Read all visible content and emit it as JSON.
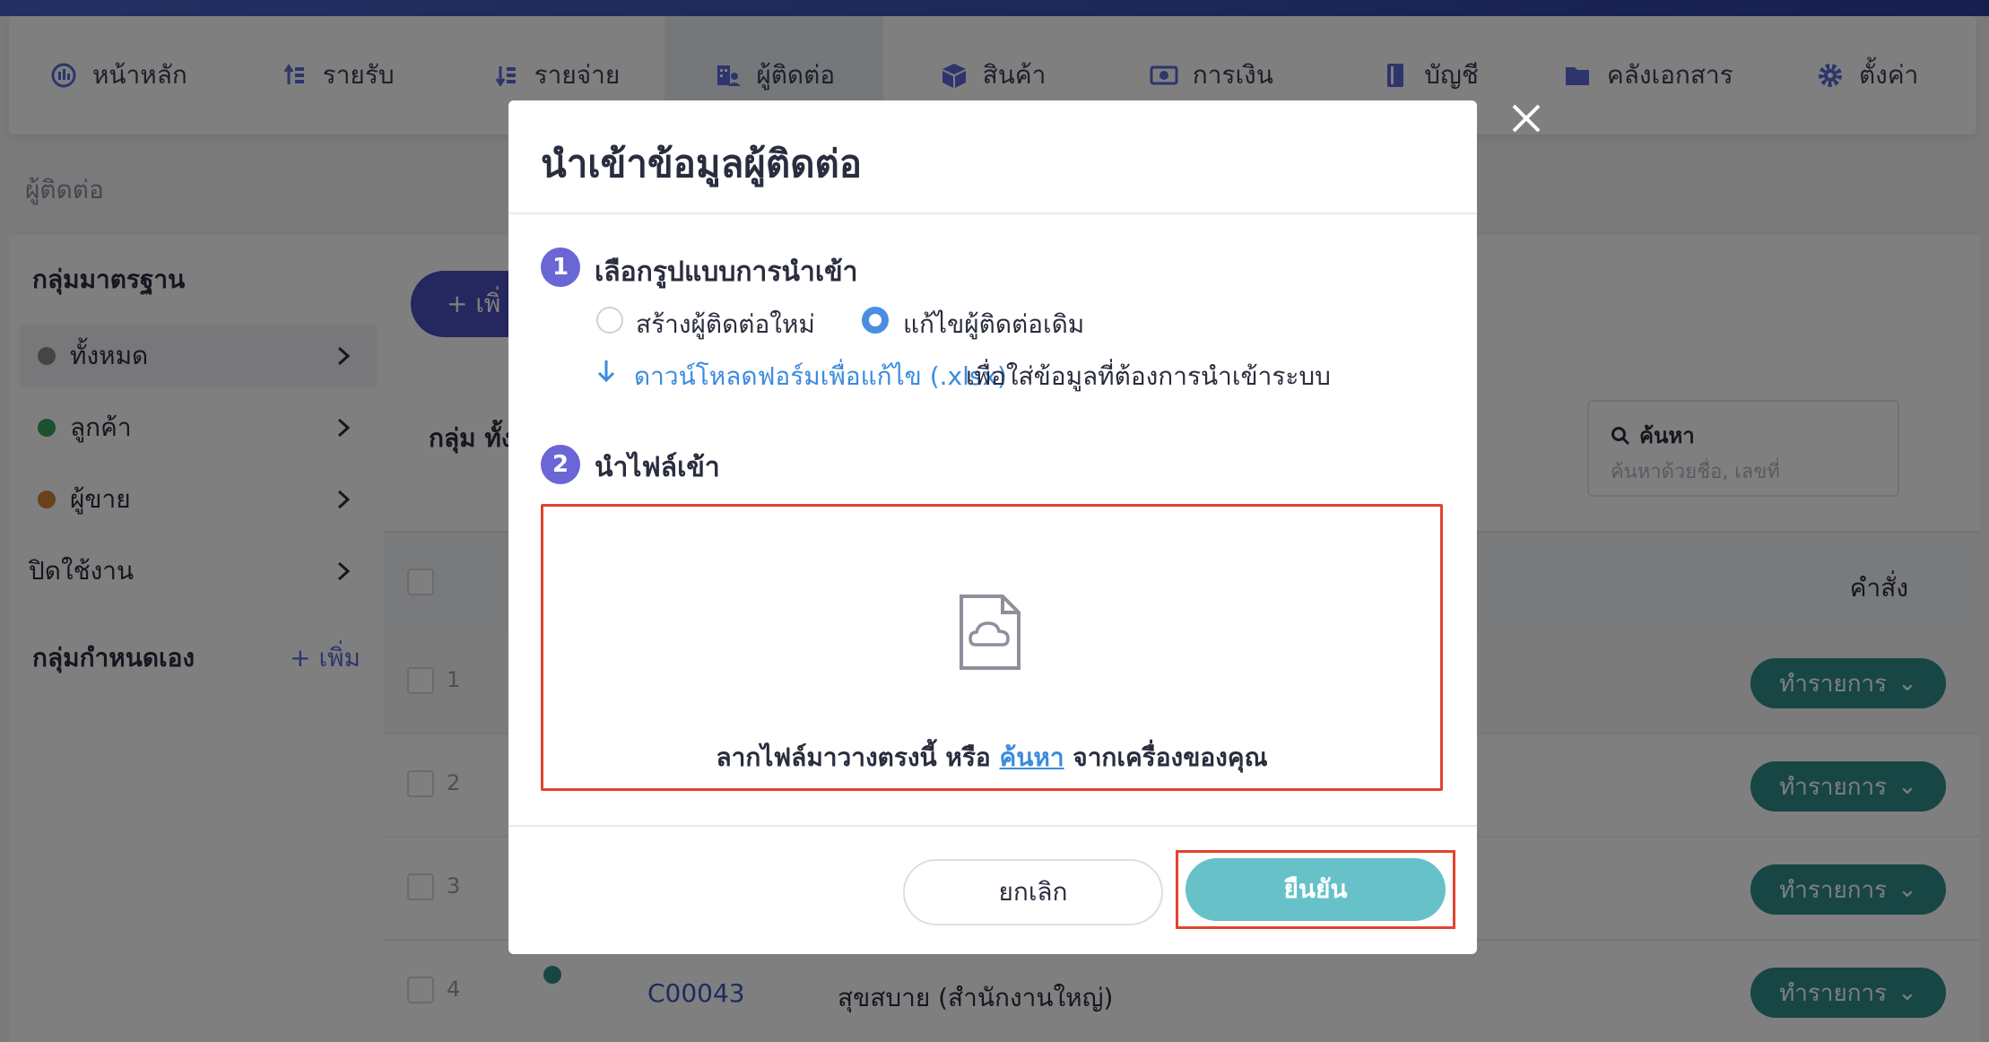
{
  "nav": {
    "items": [
      {
        "label": "หน้าหลัก",
        "icon": "dashboard-icon"
      },
      {
        "label": "รายรับ",
        "icon": "income-icon"
      },
      {
        "label": "รายจ่าย",
        "icon": "expense-icon"
      },
      {
        "label": "ผู้ติดต่อ",
        "icon": "contacts-icon"
      },
      {
        "label": "สินค้า",
        "icon": "box-icon"
      },
      {
        "label": "การเงิน",
        "icon": "money-icon"
      },
      {
        "label": "บัญชี",
        "icon": "ledger-icon"
      },
      {
        "label": "คลังเอกสาร",
        "icon": "folder-icon"
      },
      {
        "label": "ตั้งค่า",
        "icon": "gear-icon"
      }
    ],
    "active_index": 3
  },
  "breadcrumb": "ผู้ติดต่อ",
  "sidebar": {
    "standard_title": "กลุ่มมาตรฐาน",
    "items": [
      {
        "label": "ทั้งหมด",
        "color": "#8a8a8a"
      },
      {
        "label": "ลูกค้า",
        "color": "#3aa05a"
      },
      {
        "label": "ผู้ขาย",
        "color": "#d4823a"
      },
      {
        "label": "ปิดใช้งาน",
        "color": ""
      }
    ],
    "custom_title": "กลุ่มกำหนดเอง",
    "add_label": "+ เพิ่ม"
  },
  "main": {
    "add_button": "+ เพิ่",
    "group_label": "กลุ่ม ทั้ง",
    "search_label": "ค้นหา",
    "search_placeholder": "ค้นหาด้วยชื่อ, เลขที่",
    "column_command": "คำสั่ง",
    "rows": [
      {
        "num": "1",
        "code": "",
        "name": "",
        "action": "ทำรายการ"
      },
      {
        "num": "2",
        "code": "",
        "name": "",
        "action": "ทำรายการ"
      },
      {
        "num": "3",
        "code": "",
        "name": "",
        "action": "ทำรายการ"
      },
      {
        "num": "4",
        "code": "C00043",
        "name": "สุขสบาย (สำนักงานใหญ่)",
        "action": "ทำรายการ"
      }
    ]
  },
  "modal": {
    "title": "นำเข้าข้อมูลผู้ติดต่อ",
    "step1": {
      "num": "1",
      "title": "เลือกรูปแบบการนำเข้า"
    },
    "options": [
      {
        "label": "สร้างผู้ติดต่อใหม่",
        "selected": false
      },
      {
        "label": "แก้ไขผู้ติดต่อเดิม",
        "selected": true
      }
    ],
    "download_link": "ดาวน์โหลดฟอร์มเพื่อแก้ไข (.xlsx)",
    "download_rest": "เพื่อใส่ข้อมูลที่ต้องการนำเข้าระบบ",
    "step2": {
      "num": "2",
      "title": "นำไฟล์เข้า"
    },
    "drop_prefix": "ลากไฟล์มาวางตรงนี้ หรือ ",
    "drop_link": "ค้นหา",
    "drop_suffix": " จากเครื่องของคุณ",
    "cancel_label": "ยกเลิก",
    "confirm_label": "ยืนยัน"
  },
  "colors": {
    "accent": "#4b4fbf",
    "teal": "#2e8d8a",
    "confirm": "#66c1c9",
    "highlight": "#e2432e",
    "link": "#3b8be0"
  }
}
